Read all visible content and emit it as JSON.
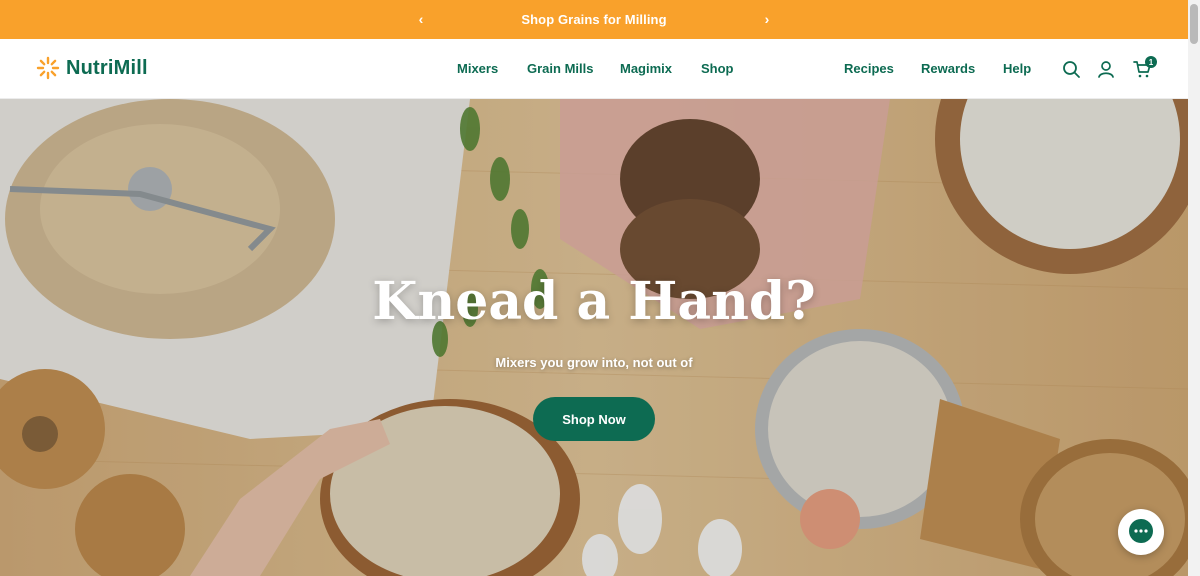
{
  "announcement": {
    "text": "Shop Grains for Milling",
    "prev_icon": "chevron-left-icon",
    "next_icon": "chevron-right-icon"
  },
  "header": {
    "logo_text": "NutriMill",
    "nav_main": [
      "Mixers",
      "Grain Mills",
      "Magimix",
      "Shop"
    ],
    "nav_secondary": [
      "Recipes",
      "Rewards",
      "Help"
    ],
    "icons": [
      "search-icon",
      "account-icon",
      "cart-icon"
    ],
    "cart_count": "1"
  },
  "hero": {
    "title": "Knead a Hand?",
    "subtitle": "Mixers you grow into, not out of",
    "cta_label": "Shop Now"
  },
  "chat": {
    "icon": "chat-icon"
  },
  "colors": {
    "announcement_bg": "#f9a12b",
    "brand_green": "#0d6b52",
    "logo_accent": "#f9a12b"
  }
}
